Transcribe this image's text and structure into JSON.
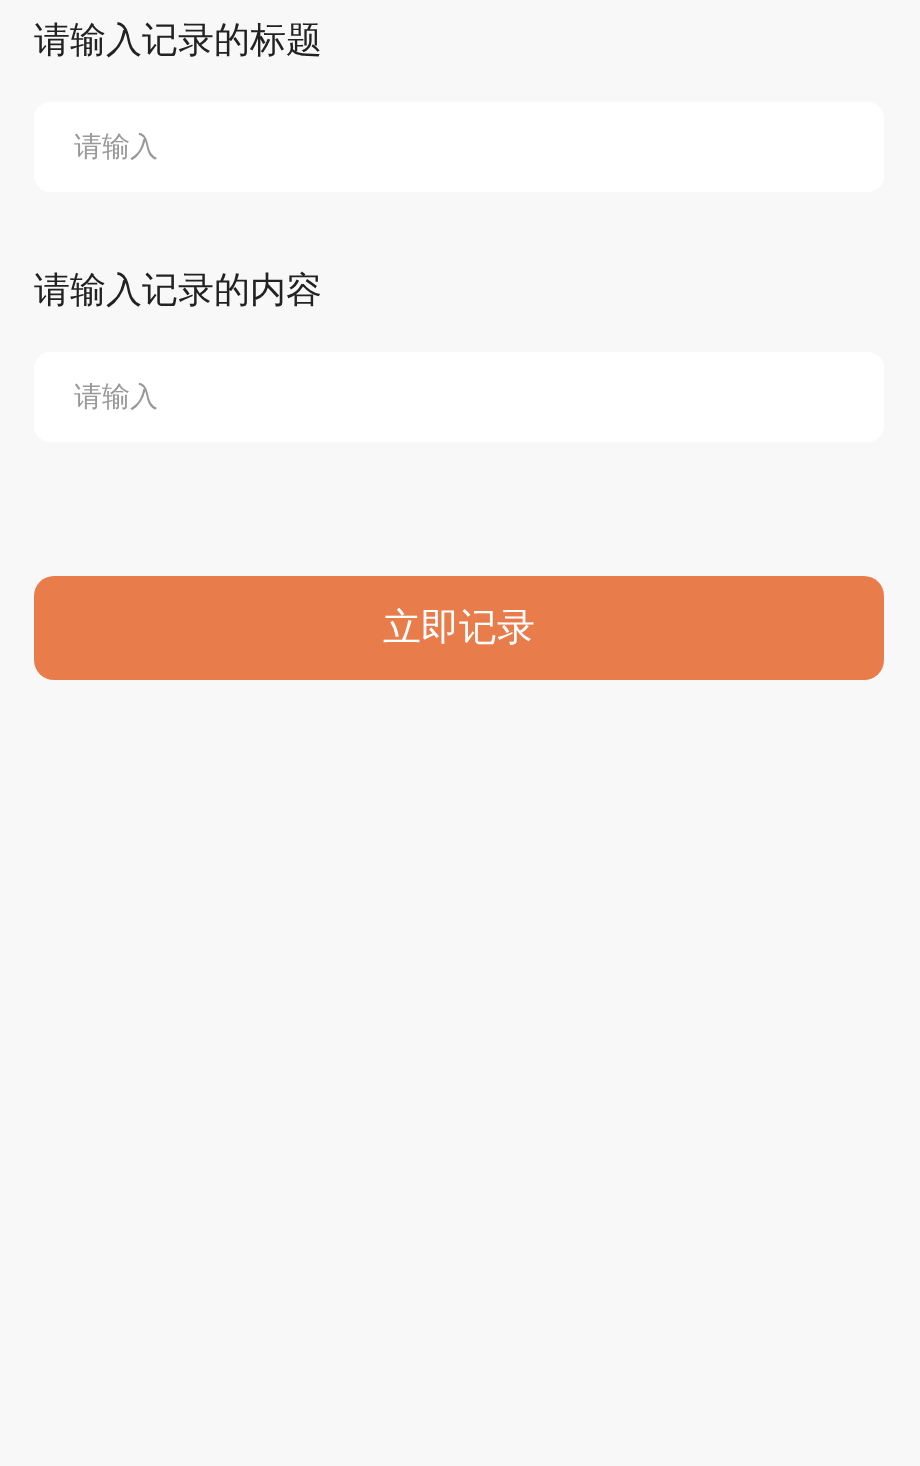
{
  "fields": [
    {
      "label": "请输入记录的标题",
      "placeholder": "请输入"
    },
    {
      "label": "请输入记录的内容",
      "placeholder": "请输入"
    }
  ],
  "submit_button": "立即记录"
}
